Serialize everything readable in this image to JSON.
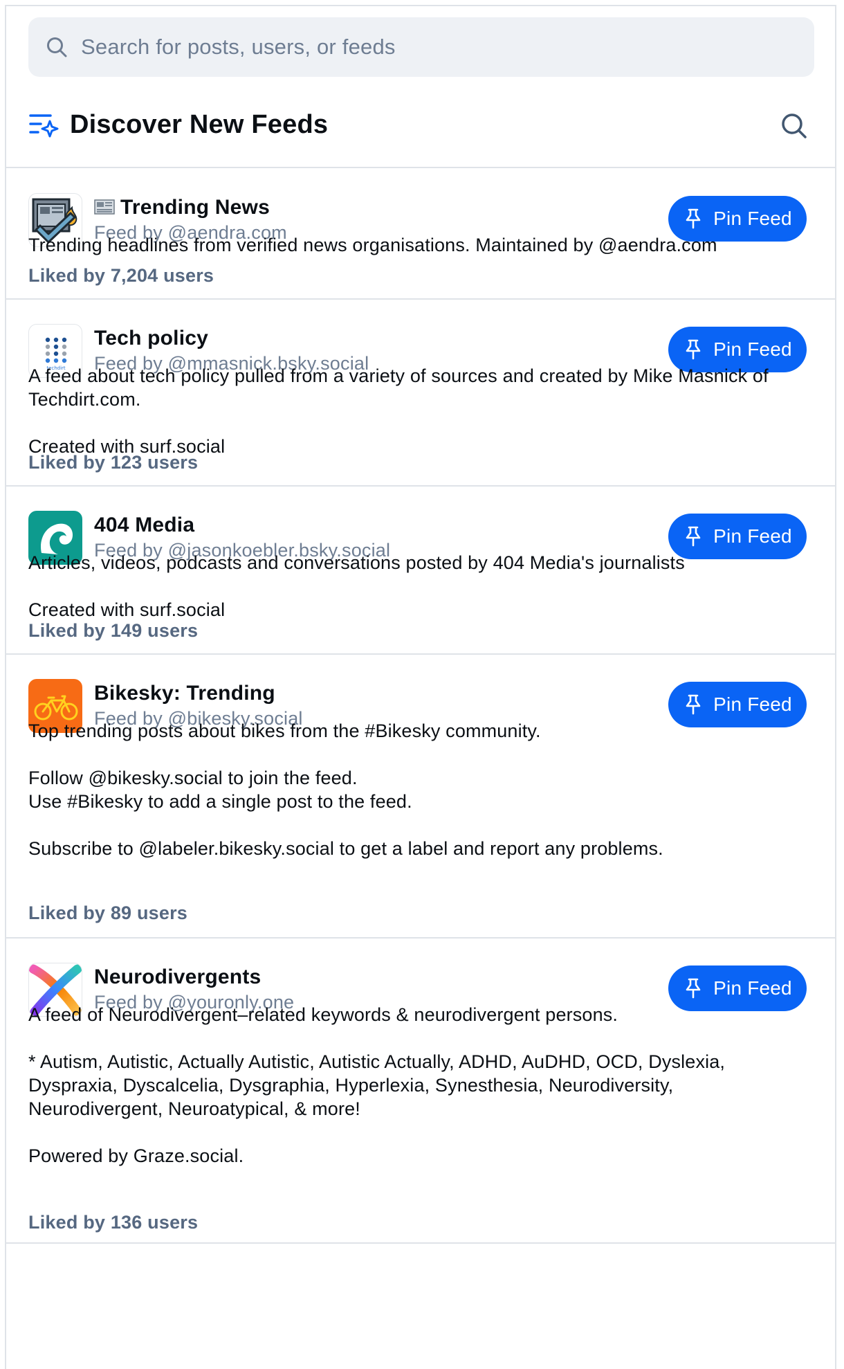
{
  "search": {
    "placeholder": "Search for posts, users, or feeds"
  },
  "header": {
    "title": "Discover New Feeds"
  },
  "pin_label": "Pin Feed",
  "colors": {
    "accent": "#0a64f5",
    "muted": "#6e7d92",
    "likes": "#566881",
    "border": "#dfe3e8"
  },
  "feeds": [
    {
      "name": "Trending News",
      "name_prefix_icon": "newspaper-emoji",
      "by": "Feed by @aendra.com",
      "description": [
        "Trending headlines from verified news organisations. Maintained by @aendra.com"
      ],
      "likes": "Liked by 7,204 users",
      "avatar_icon": "checked-newspaper-avatar"
    },
    {
      "name": "Tech policy",
      "by": "Feed by @mmasnick.bsky.social",
      "description": [
        "A feed about tech policy pulled from a variety of sources and created by Mike Masnick of Techdirt.com.",
        "",
        "Created with surf.social"
      ],
      "likes": "Liked by 123 users",
      "avatar_icon": "techdirt-logo-avatar",
      "avatar_text": "techdirt"
    },
    {
      "name": "404 Media",
      "by": "Feed by @jasonkoebler.bsky.social",
      "description": [
        "Articles, videos, podcasts and conversations posted by 404 Media's journalists",
        "",
        "Created with surf.social"
      ],
      "likes": "Liked by 149 users",
      "avatar_icon": "wave-logo-avatar"
    },
    {
      "name": "Bikesky: Trending",
      "by": "Feed by @bikesky.social",
      "description": [
        "Top trending posts about bikes from the #Bikesky community.",
        "",
        "Follow @bikesky.social to join the feed.",
        "Use #Bikesky to add a single post to the feed.",
        "",
        "Subscribe to @labeler.bikesky.social to get a label and report any problems."
      ],
      "likes": "Liked by 89 users",
      "avatar_icon": "bicycle-avatar"
    },
    {
      "name": "Neurodivergents",
      "by": "Feed by @youronly.one",
      "description": [
        "A feed of Neurodivergent–related keywords & neurodivergent persons.",
        "",
        "* Autism, Autistic, Actually Autistic, Autistic Actually, ADHD, AuDHD, OCD, Dyslexia, Dyspraxia, Dyscalcelia, Dysgraphia, Hyperlexia, Synesthesia, Neurodiversity, Neurodivergent, Neuroatypical, & more!",
        "",
        "Powered by Graze.social."
      ],
      "likes": "Liked by 136 users",
      "avatar_icon": "rainbow-x-avatar"
    }
  ]
}
